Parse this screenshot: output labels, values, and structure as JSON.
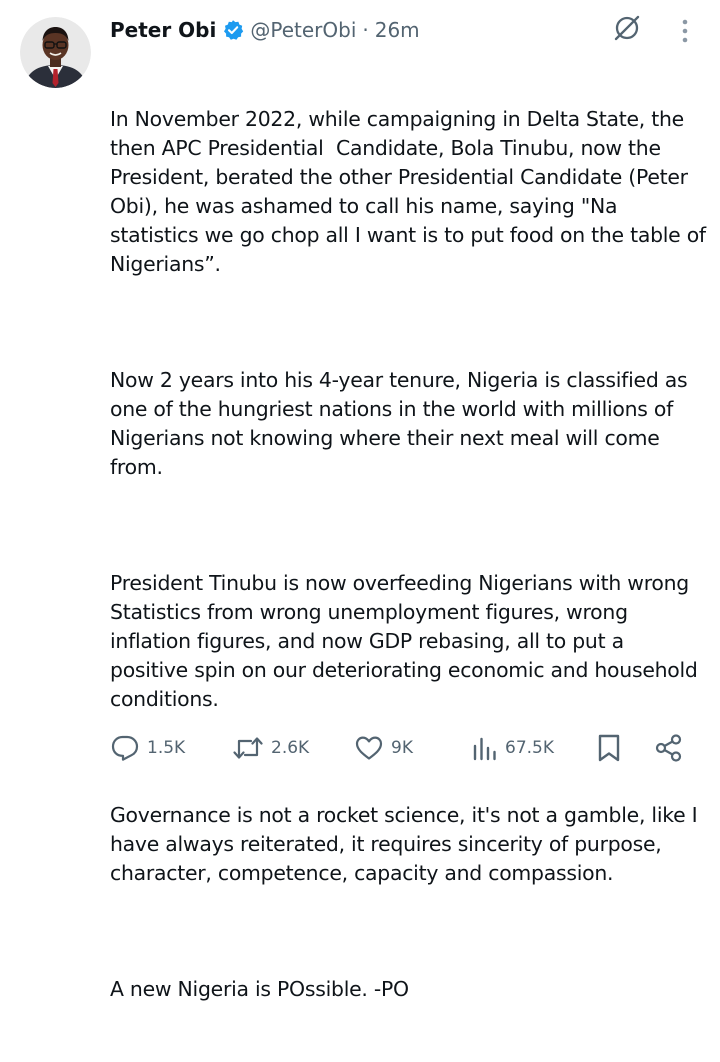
{
  "author": {
    "name": "Peter Obi",
    "handle": "@PeterObi",
    "separator": "·",
    "time": "26m"
  },
  "tweet": {
    "paragraphs": [
      "In November 2022, while campaigning in Delta State, the then APC Presidential  Candidate, Bola Tinubu, now the President, berated the other Presidential Candidate (Peter Obi), he was ashamed to call his name, saying \"Na statistics we go chop all I want is to put food on the table of Nigerians”.",
      "Now 2 years into his 4-year tenure, Nigeria is classified as one of the hungriest nations in the world with millions of Nigerians not knowing where their next meal will come from.",
      "President Tinubu is now overfeeding Nigerians with wrong Statistics from wrong unemployment figures, wrong inflation figures, and now GDP rebasing, all to put a positive spin on our deteriorating economic and household conditions.",
      "Governance is not a rocket science, it's not a gamble, like I have always reiterated, it requires sincerity of purpose, character, competence, capacity and compassion.",
      "A new Nigeria is POssible. -PO"
    ]
  },
  "actions": {
    "replies": "1.5K",
    "reposts": "2.6K",
    "likes": "9K",
    "views": "67.5K"
  },
  "icons": {
    "verified": "verified-badge-icon",
    "grok": "grok-icon",
    "more": "more-vertical-icon",
    "reply": "reply-icon",
    "repost": "repost-icon",
    "like": "heart-icon",
    "views": "analytics-icon",
    "bookmark": "bookmark-icon",
    "share": "share-icon"
  },
  "colors": {
    "text": "#0f1419",
    "secondary": "#536471",
    "verified": "#1d9bf0"
  }
}
